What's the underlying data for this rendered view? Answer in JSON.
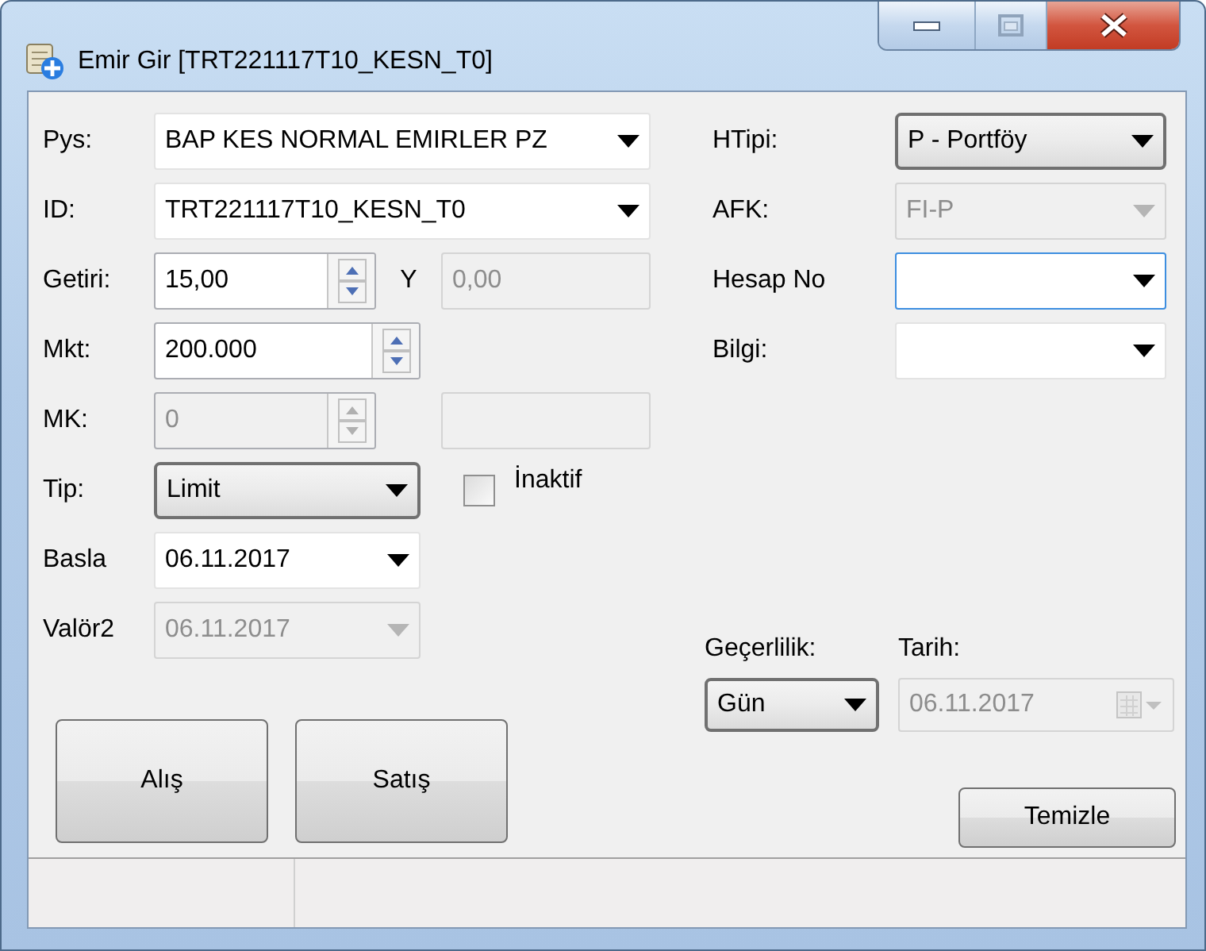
{
  "window": {
    "title": "Emir Gir [TRT221117T10_KESN_T0]",
    "caption_buttons": [
      {
        "kind": "minimize"
      },
      {
        "kind": "maximize"
      },
      {
        "kind": "close"
      }
    ]
  },
  "left_fields": [
    {
      "label": "Pys:",
      "kind": "combo",
      "value": "BAP KES NORMAL EMIRLER PZ",
      "disabled": false
    },
    {
      "label": "ID:",
      "kind": "combo",
      "value": "TRT221117T10_KESN_T0",
      "disabled": false
    },
    {
      "label": "Getiri:",
      "kind": "spin",
      "value": "15,00",
      "disabled": false,
      "extra": {
        "label": "Y",
        "value": "0,00",
        "disabled": true
      }
    },
    {
      "label": "Mkt:",
      "kind": "spin",
      "value": "200.000",
      "disabled": false
    },
    {
      "label": "MK:",
      "kind": "spin",
      "value": "0",
      "disabled": true,
      "extra": {
        "disabled": true
      }
    },
    {
      "label": "Tip:",
      "kind": "dropdown",
      "value": "Limit",
      "disabled": false,
      "checkbox": {
        "label": "İnaktif",
        "checked": false
      }
    },
    {
      "label": "Basla",
      "kind": "date",
      "value": "06.11.2017",
      "disabled": false
    },
    {
      "label": "Valör2",
      "kind": "date",
      "value": "06.11.2017",
      "disabled": true
    }
  ],
  "right_fields": [
    {
      "label": "HTipi:",
      "kind": "dropdown",
      "value": "P - Portföy",
      "disabled": false,
      "focused": false
    },
    {
      "label": "AFK:",
      "kind": "combo",
      "value": "FI-P",
      "disabled": true,
      "focused": false
    },
    {
      "label": "Hesap No",
      "kind": "combo",
      "disabled": false,
      "focused": true
    },
    {
      "label": "Bilgi:",
      "kind": "combo",
      "disabled": false,
      "focused": false
    }
  ],
  "validity": {
    "label": "Geçerlilik:",
    "kind": "dropdown",
    "value": "Gün",
    "disabled": false
  },
  "validity_date": {
    "label": "Tarih:",
    "kind": "datepicker",
    "value": "06.11.2017",
    "disabled": true
  },
  "actions": [
    {
      "label": "Alış"
    },
    {
      "label": "Satış"
    }
  ],
  "clear_button": {
    "label": "Temizle"
  }
}
